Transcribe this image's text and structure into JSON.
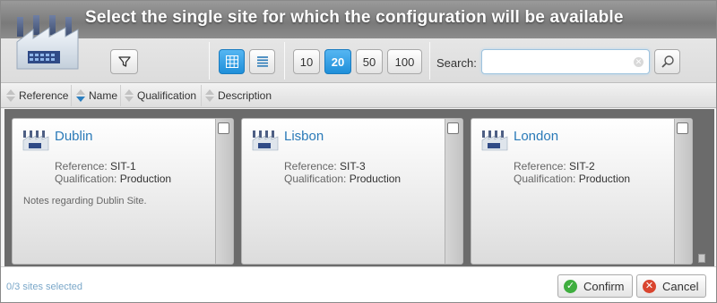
{
  "dialog": {
    "title": "Select the single site for which the configuration will be available"
  },
  "toolbar": {
    "filter_icon": "filter-icon",
    "view_grid_icon": "grid-view-icon",
    "view_list_icon": "list-view-icon",
    "page_sizes": [
      "10",
      "20",
      "50",
      "100"
    ],
    "active_page_size": "20",
    "search_label": "Search:",
    "search_value": "",
    "search_icon": "search-icon"
  },
  "sort": {
    "columns": [
      "Reference",
      "Name",
      "Qualification",
      "Description"
    ],
    "active": "Name"
  },
  "cards": [
    {
      "name": "Dublin",
      "reference_label": "Reference:",
      "reference": "SIT-1",
      "qualification_label": "Qualification:",
      "qualification": "Production",
      "notes": "Notes regarding Dublin Site."
    },
    {
      "name": "Lisbon",
      "reference_label": "Reference:",
      "reference": "SIT-3",
      "qualification_label": "Qualification:",
      "qualification": "Production",
      "notes": ""
    },
    {
      "name": "London",
      "reference_label": "Reference:",
      "reference": "SIT-2",
      "qualification_label": "Qualification:",
      "qualification": "Production",
      "notes": ""
    }
  ],
  "footer": {
    "status": "0/3 sites selected",
    "confirm_label": "Confirm",
    "cancel_label": "Cancel"
  },
  "colors": {
    "accent": "#1f8fd9",
    "link": "#2a7ab8",
    "confirm": "#3fae3f",
    "cancel": "#d9452f"
  }
}
